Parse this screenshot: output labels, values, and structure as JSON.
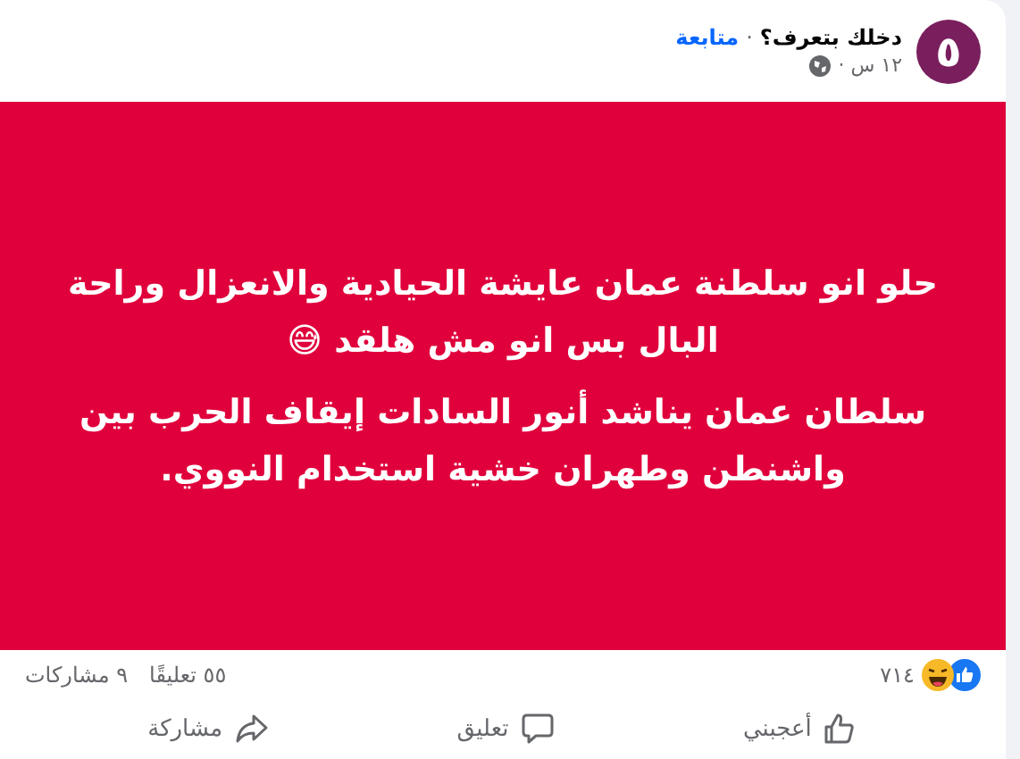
{
  "post": {
    "avatar_text": "٥",
    "author": "دخلك بتعرف؟",
    "separator": "·",
    "follow": "متابعة",
    "time": "١٢ س ·",
    "paragraphs": [
      "حلو انو سلطنة عمان عايشة الحيادية والانعزال وراحة البال بس انو مش هلقد 😅",
      "سلطان عمان يناشد أنور السادات إيقاف الحرب بين واشنطن وطهران خشية استخدام النووي."
    ],
    "reaction_count": "٧١٤",
    "comments": "٥٥ تعليقًا",
    "shares": "٩ مشاركات",
    "actions": [
      {
        "kind": "like",
        "label": "أعجبني"
      },
      {
        "kind": "comment",
        "label": "تعليق"
      },
      {
        "kind": "share",
        "label": "مشاركة"
      }
    ]
  }
}
